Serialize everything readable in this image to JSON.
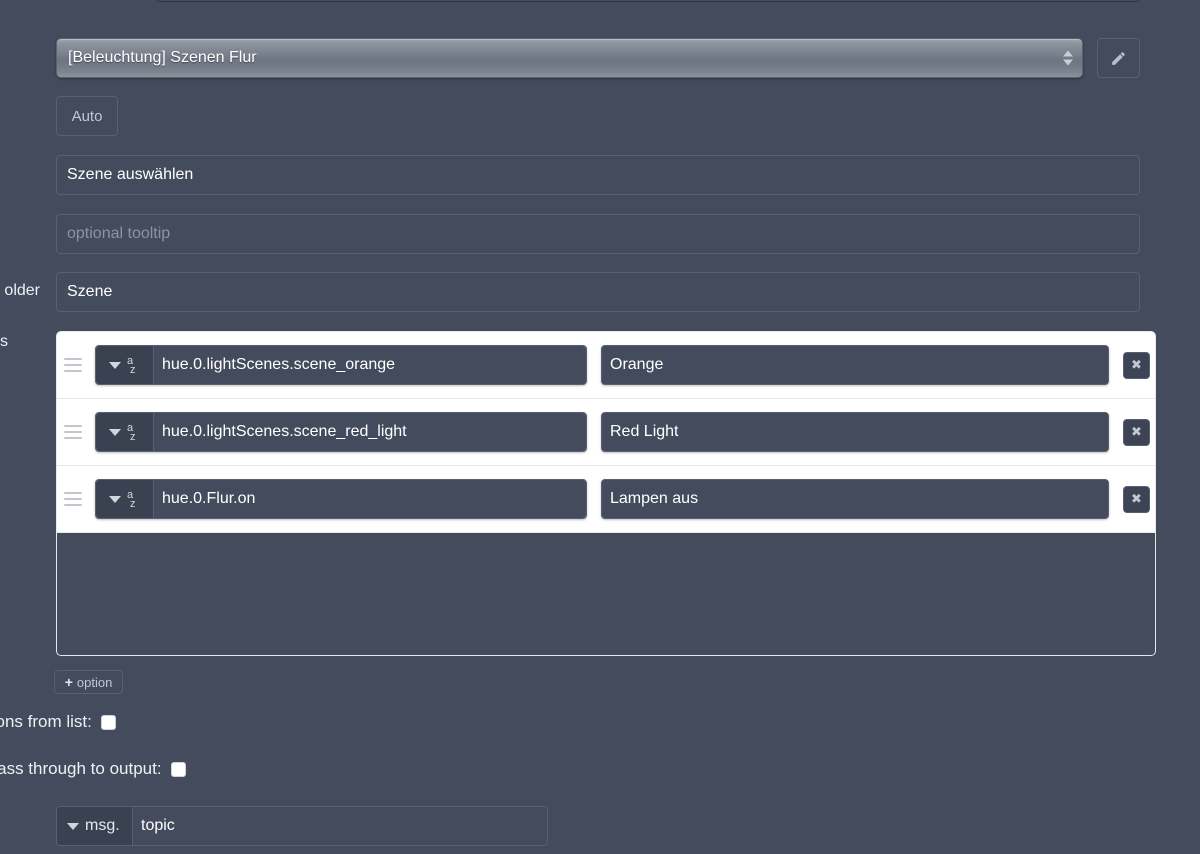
{
  "node_select": {
    "value": "[Beleuchtung] Szenen Flur",
    "edit_icon": "pencil-icon"
  },
  "size_button": {
    "label": "Auto"
  },
  "fields": {
    "label": {
      "value": "Szene auswählen",
      "placeholder": ""
    },
    "tooltip": {
      "value": "",
      "placeholder": "optional tooltip"
    },
    "placeholder": {
      "value": "Szene",
      "placeholder": ""
    }
  },
  "edge_labels": {
    "placeholder": "older",
    "options": "s"
  },
  "options_list": {
    "rows": [
      {
        "type_icon": "az-icon",
        "value": "hue.0.lightScenes.scene_orange",
        "label": "Orange",
        "delete_icon": "close-icon"
      },
      {
        "type_icon": "az-icon",
        "value": "hue.0.lightScenes.scene_red_light",
        "label": "Red Light",
        "delete_icon": "close-icon"
      },
      {
        "type_icon": "az-icon",
        "value": "hue.0.Flur.on",
        "label": "Lampen aus",
        "delete_icon": "close-icon"
      }
    ]
  },
  "add_option": {
    "plus": "+",
    "label": "option"
  },
  "checkboxes": [
    {
      "label": "multiple selections from list:",
      "checked": false
    },
    {
      "label": "arrives on input, pass through to output:",
      "checked": false
    }
  ],
  "topic": {
    "prefix": "msg.",
    "value": "topic"
  },
  "colors": {
    "background": "#434b5c",
    "input_border": "#5a6070",
    "text": "#ffffff",
    "placeholder_text": "#8d93a0",
    "list_white": "#ffffff",
    "type_chip": "#3a4150"
  }
}
